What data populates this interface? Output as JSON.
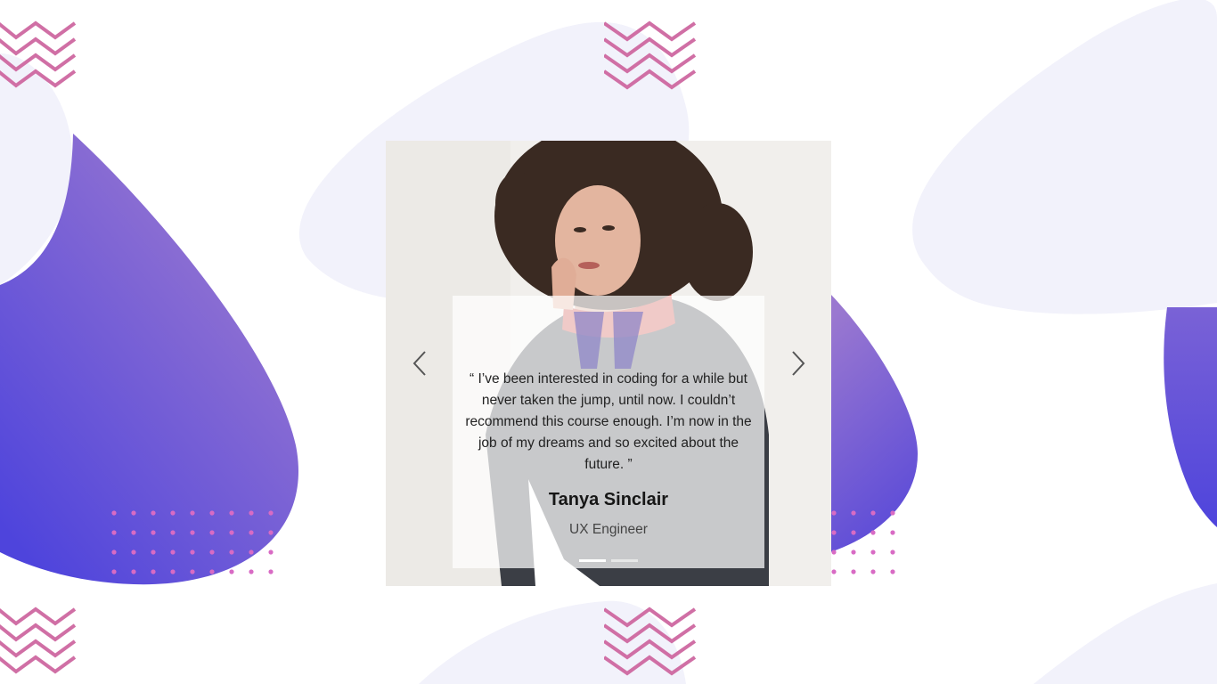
{
  "testimonial": {
    "quote": "“ I’ve been interested in coding for a while but never taken the jump, until now. I couldn’t recommend this course enough. I’m now in the job of my dreams and so excited about the future. ”",
    "name": "Tanya Sinclair",
    "role": "UX Engineer"
  },
  "carousel": {
    "prev_icon": "chevron-left-icon",
    "next_icon": "chevron-right-icon",
    "slide_count": 2,
    "active_slide": 1
  },
  "colors": {
    "blob_light": "#f2f2fb",
    "gradient_start": "#9a78d0",
    "gradient_end": "#4e44dc",
    "zigzag": "#d06fa5",
    "dots": "#d86bc4",
    "quote_mark": "#8f86c8"
  }
}
